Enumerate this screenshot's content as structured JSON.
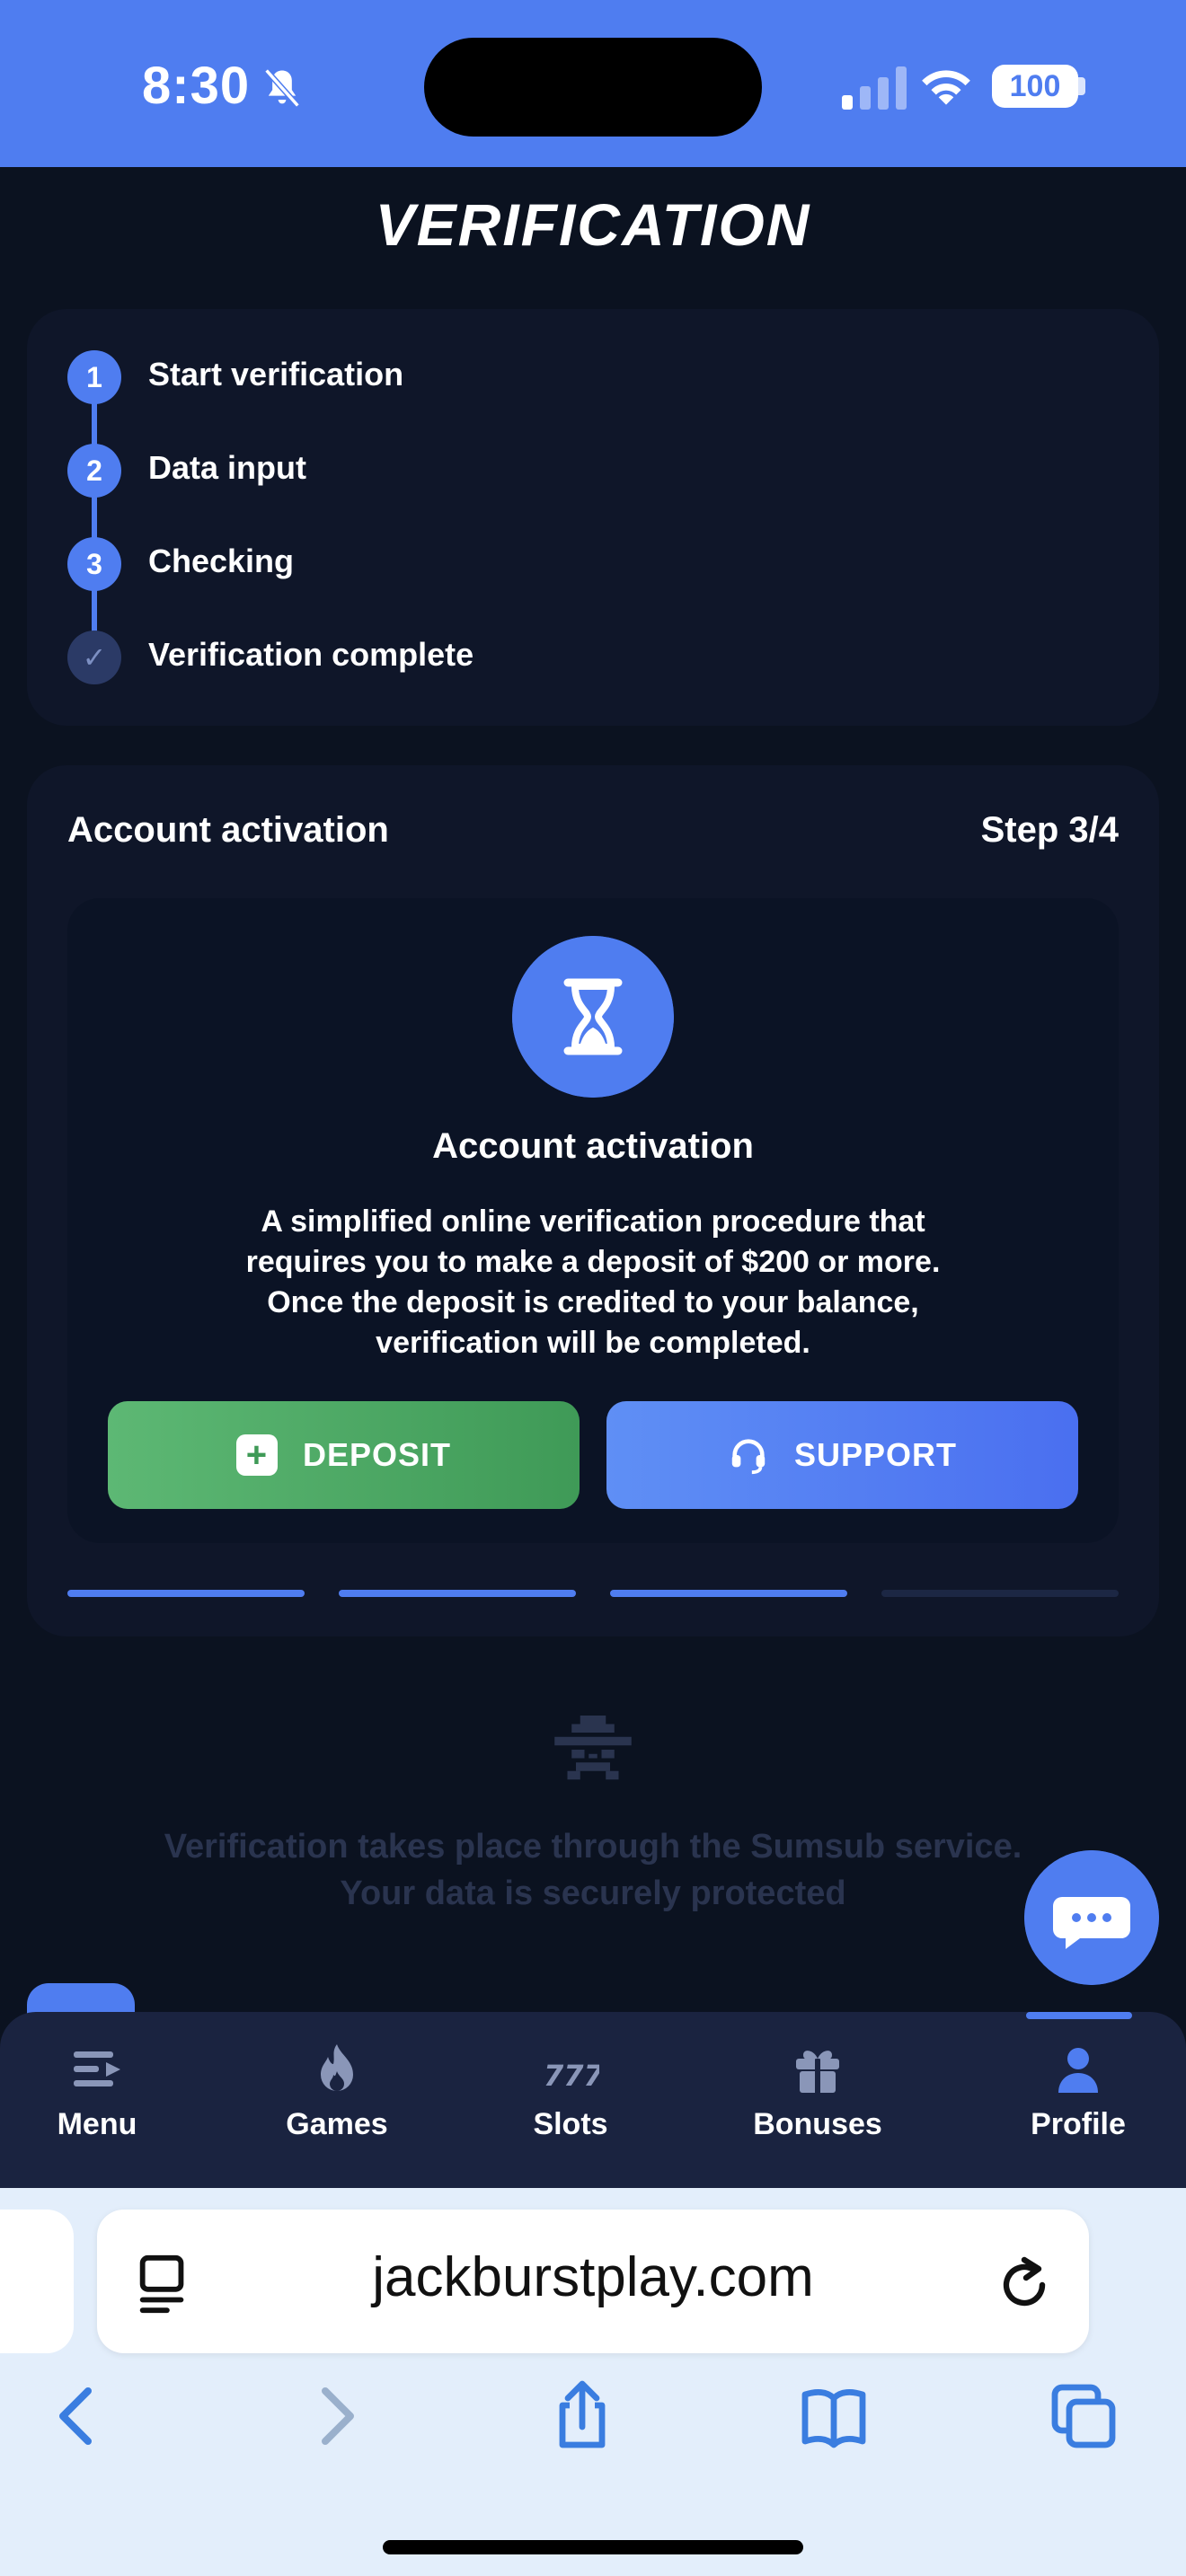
{
  "status_bar": {
    "time": "8:30",
    "battery": "100"
  },
  "page_title": "VERIFICATION",
  "steps": [
    {
      "number": "1",
      "label": "Start verification"
    },
    {
      "number": "2",
      "label": "Data input"
    },
    {
      "number": "3",
      "label": "Checking"
    },
    {
      "number": "✓",
      "label": "Verification complete"
    }
  ],
  "activation": {
    "title": "Account activation",
    "step": "Step 3/4",
    "inner_title": "Account activation",
    "description": "A simplified online verification procedure that requires you to make a deposit of $200 or more. Once the deposit is credited to your balance, verification will be completed.",
    "deposit_label": "DEPOSIT",
    "support_label": "SUPPORT",
    "progress_completed": 3,
    "progress_total": 4
  },
  "info": {
    "line1": "Verification takes place through the Sumsub service.",
    "line2": "Your data is securely protected"
  },
  "nav": {
    "items": [
      {
        "label": "Menu",
        "icon": "menu-icon"
      },
      {
        "label": "Games",
        "icon": "flame-icon"
      },
      {
        "label": "Slots",
        "icon": "slots-777-icon"
      },
      {
        "label": "Bonuses",
        "icon": "gift-icon"
      },
      {
        "label": "Profile",
        "icon": "profile-icon"
      }
    ],
    "active": "Profile"
  },
  "browser": {
    "url": "jackburstplay.com"
  },
  "colors": {
    "accent": "#4f7df0",
    "deposit": "#4caf64",
    "background": "#0b1220"
  }
}
